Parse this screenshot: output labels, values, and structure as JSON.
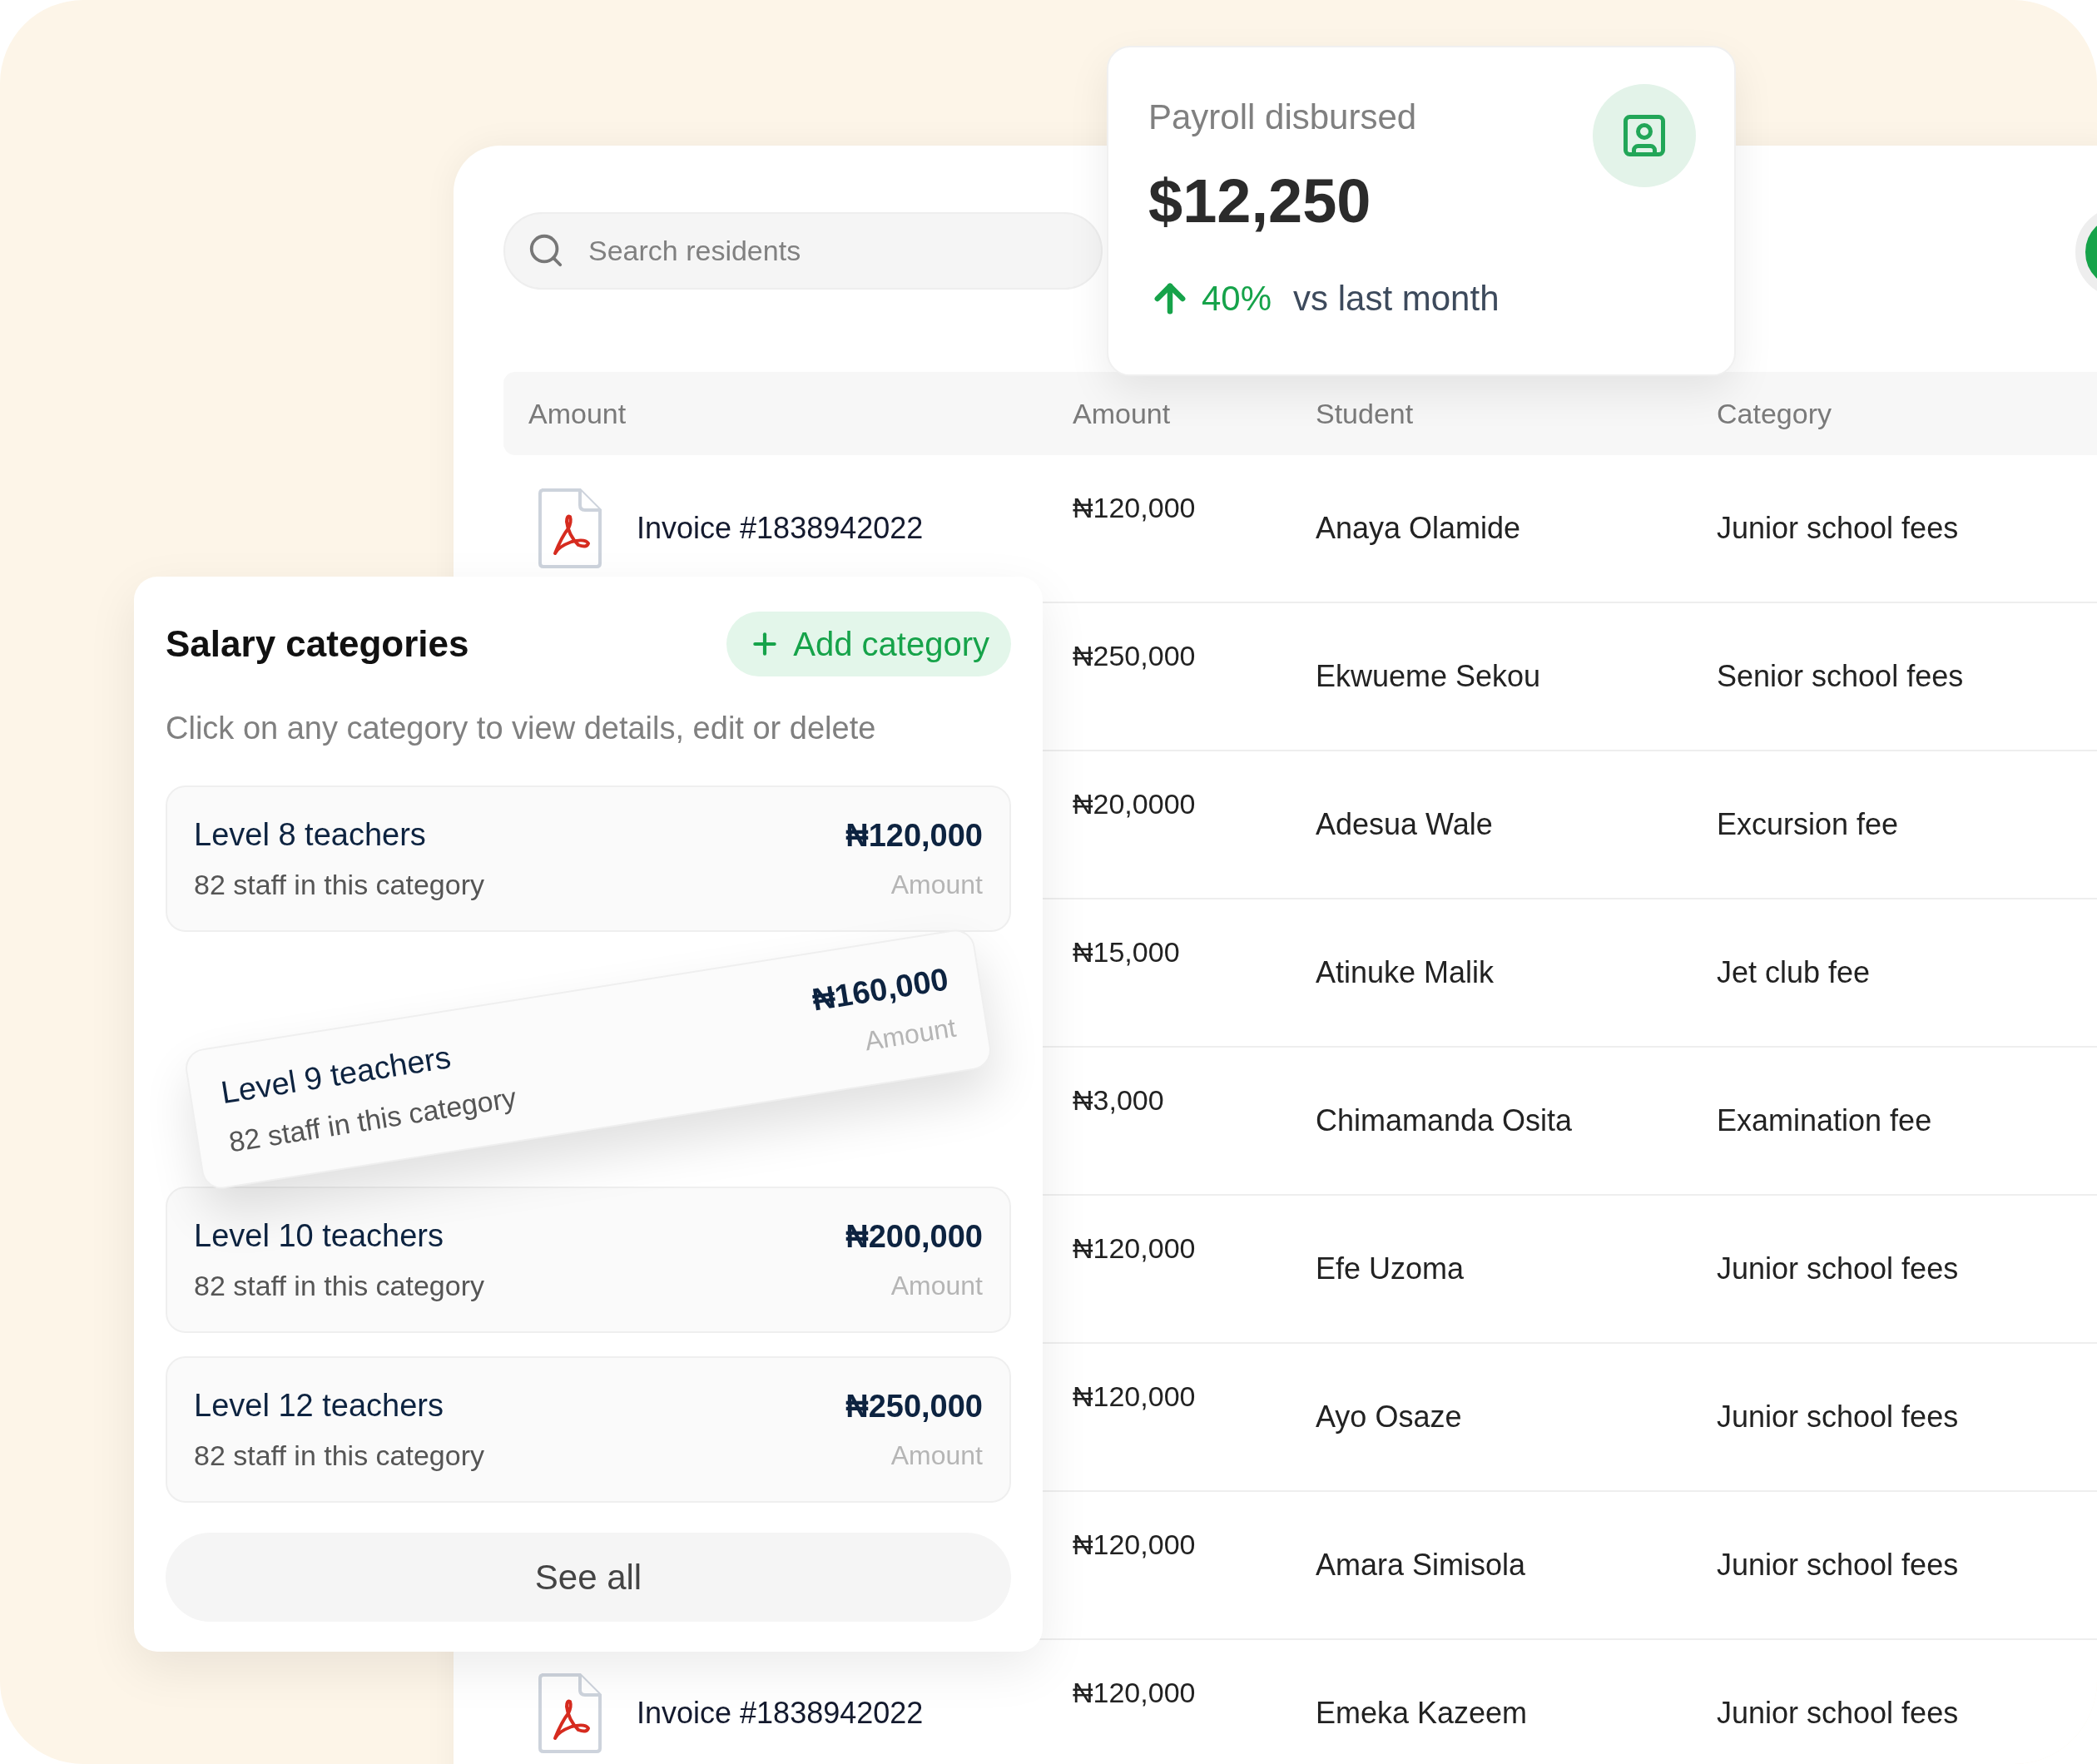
{
  "search": {
    "placeholder": "Search residents"
  },
  "table": {
    "columns": [
      "Amount",
      "Amount",
      "Student",
      "Category"
    ],
    "rows": [
      {
        "document": "Invoice #1838942022",
        "amount": "₦120,000",
        "student": "Anaya Olamide",
        "category": "Junior school fees"
      },
      {
        "amount": "₦250,000",
        "student": "Ekwueme Sekou",
        "category": "Senior school fees"
      },
      {
        "amount": "₦20,0000",
        "student": "Adesua Wale",
        "category": "Excursion fee"
      },
      {
        "amount": "₦15,000",
        "student": "Atinuke Malik",
        "category": "Jet club fee"
      },
      {
        "amount": "₦3,000",
        "student": "Chimamanda Osita",
        "category": "Examination fee"
      },
      {
        "amount": "₦120,000",
        "student": "Efe Uzoma",
        "category": "Junior school fees"
      },
      {
        "amount": "₦120,000",
        "student": "Ayo Osaze",
        "category": "Junior school fees"
      },
      {
        "amount": "₦120,000",
        "student": "Amara Simisola",
        "category": "Junior school fees"
      },
      {
        "document": "Invoice #1838942022",
        "amount": "₦120,000",
        "student": "Emeka Kazeem",
        "category": "Junior school fees"
      }
    ]
  },
  "payroll": {
    "title": "Payroll disbursed",
    "value": "$12,250",
    "trend": {
      "percent": "40%",
      "label": "vs last month"
    }
  },
  "salary_categories": {
    "title": "Salary categories",
    "add_button": "Add category",
    "subtitle": "Click on any category to view details, edit or delete",
    "items": [
      {
        "kind": "flat",
        "name": "Level 8 teachers",
        "staff": "82 staff in this category",
        "amount": "₦120,000",
        "amount_label": "Amount"
      },
      {
        "kind": "tilted",
        "name": "Level 9 teachers",
        "staff": "82 staff in this category",
        "amount": "₦160,000",
        "amount_label": "Amount"
      },
      {
        "kind": "flat",
        "name": "Level 10 teachers",
        "staff": "82 staff in this category",
        "amount": "₦200,000",
        "amount_label": "Amount"
      },
      {
        "kind": "flat",
        "name": "Level 12 teachers",
        "staff": "82 staff in this category",
        "amount": "₦250,000",
        "amount_label": "Amount"
      }
    ],
    "see_all": "See all"
  }
}
